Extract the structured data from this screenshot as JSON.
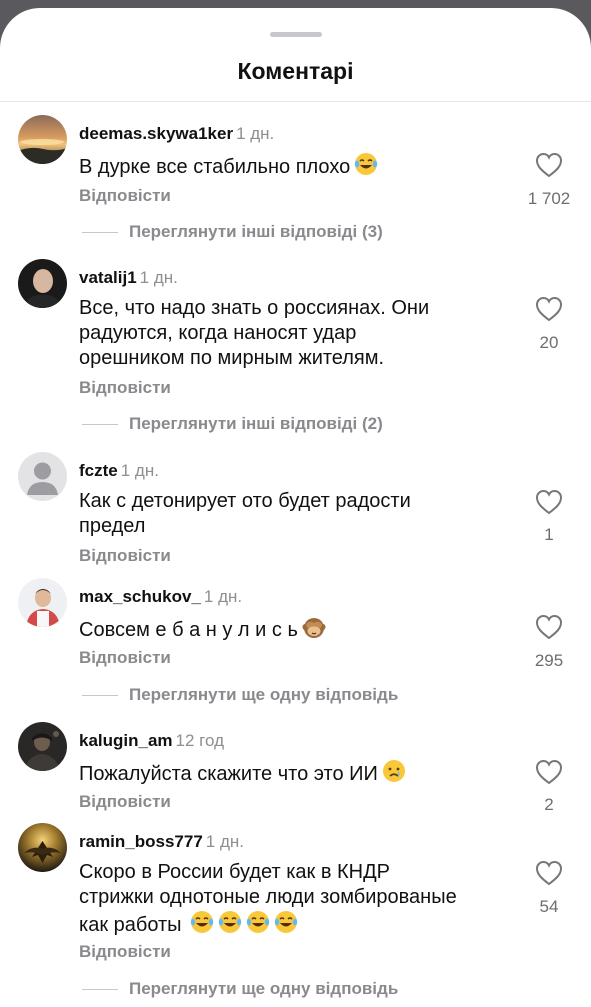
{
  "sheet": {
    "title": "Коментарі"
  },
  "comments": [
    {
      "username": "deemas.skywa1ker",
      "time": "1 дн.",
      "lines": [
        "В дурке все стабильно плохо"
      ],
      "emoji": [
        "laughing-tears"
      ],
      "reply_label": "Відповісти",
      "likes": "1 702",
      "thread_label": "Переглянути інші відповіді (3)"
    },
    {
      "username": "vatalij1",
      "time": "1 дн.",
      "lines": [
        "Все, что надо знать о россиянах. Они",
        "радуются, когда наносят удар",
        "орешником по мирным жителям."
      ],
      "emoji": [],
      "reply_label": "Відповісти",
      "likes": "20",
      "thread_label": "Переглянути інші відповіді (2)"
    },
    {
      "username": "fczte",
      "time": "1 дн.",
      "lines": [
        "Как с детонирует ото будет радости",
        "предел"
      ],
      "emoji": [],
      "reply_label": "Відповісти",
      "likes": "1",
      "thread_label": ""
    },
    {
      "username": "max_schukov_",
      "time": "1 дн.",
      "lines": [
        "Совсем е б а н у л и с ь"
      ],
      "emoji": [
        "see-no-evil-monkey"
      ],
      "reply_label": "Відповісти",
      "likes": "295",
      "thread_label": "Переглянути ще одну відповідь"
    },
    {
      "username": "kalugin_am",
      "time": "12 год",
      "lines": [
        "Пожалуйста скажите что это ИИ"
      ],
      "emoji": [
        "crying-face"
      ],
      "reply_label": "Відповісти",
      "likes": "2",
      "thread_label": ""
    },
    {
      "username": "ramin_boss777",
      "time": "1 дн.",
      "lines": [
        "Скоро в России будет как в КНДР",
        "стрижки однотоные люди зомбированые",
        "как работы"
      ],
      "emoji": [
        "laughing-tears",
        "laughing-tears",
        "laughing-tears",
        "laughing-tears"
      ],
      "reply_label": "Відповісти",
      "likes": "54",
      "thread_label": "Переглянути ще одну відповідь"
    }
  ],
  "icons": {
    "like": "heart-outline-icon"
  },
  "colors": {
    "secondary_text": "#8a8a8e",
    "background": "#ffffff",
    "backdrop": "#5a5a5e"
  }
}
